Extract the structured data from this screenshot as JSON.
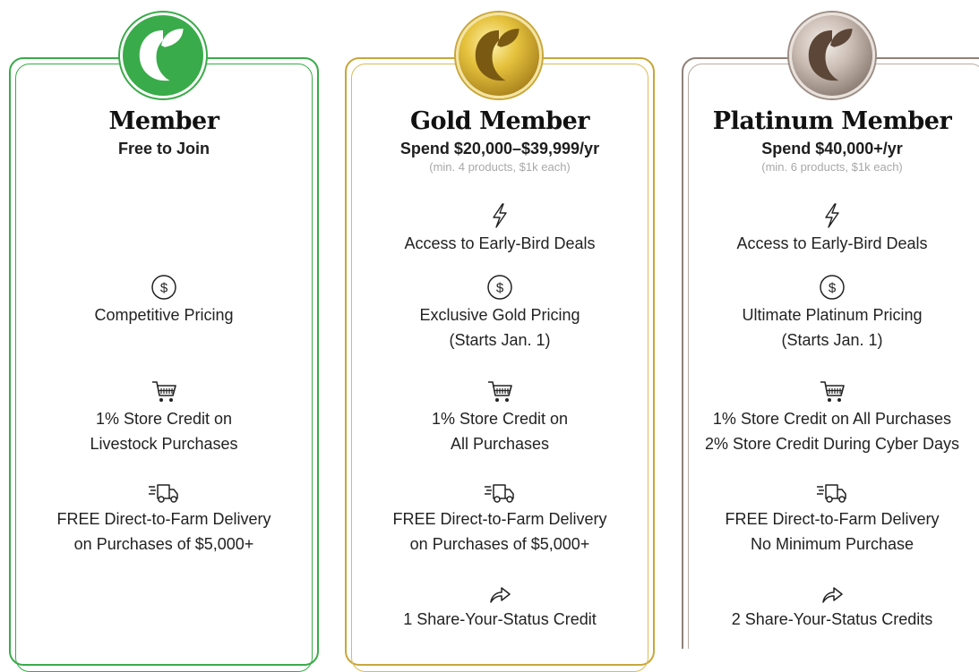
{
  "colors": {
    "member": "#3aab4a",
    "gold": "#c9a63a",
    "platinum": "#9c8e85"
  },
  "tiers": [
    {
      "title": "Member",
      "subtitle": "Free to Join",
      "features": [
        {
          "icon": "dollar-circle-icon",
          "lines": [
            "Competitive Pricing"
          ]
        },
        {
          "icon": "shopping-cart-icon",
          "lines": [
            "1% Store Credit on",
            "Livestock Purchases"
          ]
        },
        {
          "icon": "delivery-truck-icon",
          "lines": [
            "FREE Direct-to-Farm Delivery",
            "on Purchases of $5,000+"
          ]
        }
      ]
    },
    {
      "title": "Gold Member",
      "subtitle": "Spend $20,000–$39,999/yr",
      "note": "(min. 4 products, $1k each)",
      "features": [
        {
          "icon": "lightning-icon",
          "lines": [
            "Access to Early-Bird Deals"
          ]
        },
        {
          "icon": "dollar-circle-icon",
          "lines": [
            "Exclusive Gold Pricing",
            "(Starts Jan. 1)"
          ]
        },
        {
          "icon": "shopping-cart-icon",
          "lines": [
            "1% Store Credit on",
            "All Purchases"
          ]
        },
        {
          "icon": "delivery-truck-icon",
          "lines": [
            "FREE Direct-to-Farm Delivery",
            "on Purchases of $5,000+"
          ]
        },
        {
          "icon": "share-arrow-icon",
          "lines": [
            "1 Share-Your-Status Credit"
          ]
        }
      ]
    },
    {
      "title": "Platinum Member",
      "subtitle": "Spend $40,000+/yr",
      "note": "(min. 6 products, $1k each)",
      "features": [
        {
          "icon": "lightning-icon",
          "lines": [
            "Access to Early-Bird Deals"
          ]
        },
        {
          "icon": "dollar-circle-icon",
          "lines": [
            "Ultimate Platinum Pricing",
            "(Starts Jan. 1)"
          ]
        },
        {
          "icon": "shopping-cart-icon",
          "lines": [
            "1% Store Credit on All Purchases",
            "2% Store Credit During Cyber Days"
          ]
        },
        {
          "icon": "delivery-truck-icon",
          "lines": [
            "FREE Direct-to-Farm Delivery",
            "No Minimum Purchase"
          ]
        },
        {
          "icon": "share-arrow-icon",
          "lines": [
            "2 Share-Your-Status Credits"
          ]
        }
      ]
    }
  ]
}
